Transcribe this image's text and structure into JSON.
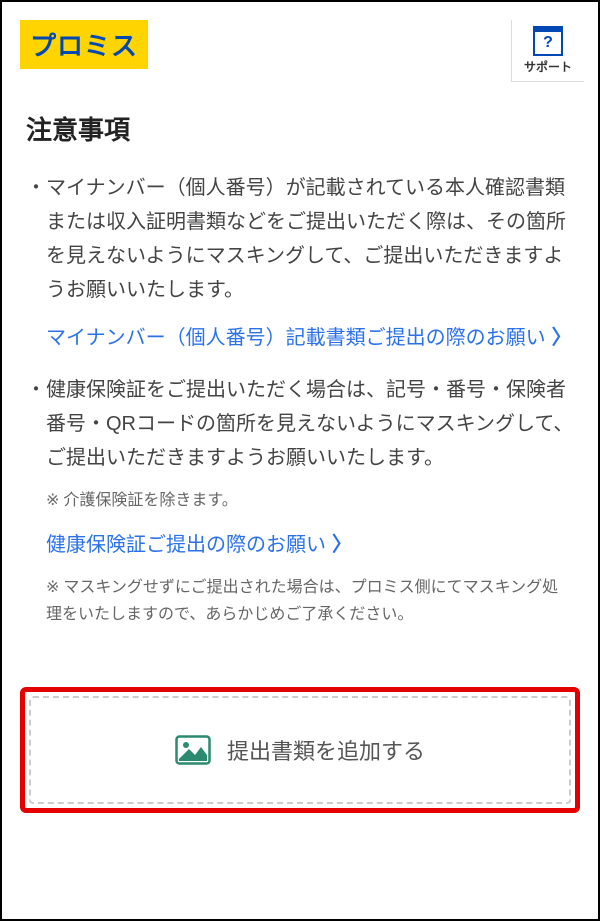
{
  "header": {
    "logo_text": "プロミス",
    "support_label": "サポート",
    "support_icon_glyph": "?"
  },
  "notice": {
    "title": "注意事項",
    "items": [
      {
        "text": "マイナンバー（個人番号）が記載されている本人確認書類または収入証明書類などをご提出いただく際は、その箇所を見えないようにマスキングして、ご提出いただきますようお願いいたします。",
        "link": "マイナンバー（個人番号）記載書類ご提出の際のお願い"
      },
      {
        "text": "健康保険証をご提出いただく場合は、記号・番号・保険者番号・QRコードの箇所を見えないようにマスキングして、ご提出いただきますようお願いいたします。",
        "footnote1": "介護保険証を除きます。",
        "link": "健康保険証ご提出の際のお願い",
        "footnote2": "マスキングせずにご提出された場合は、プロミス側にてマスキング処理をいたしますので、あらかじめご了承ください。"
      }
    ],
    "footnote_prefix": "※"
  },
  "bullet_char": "・",
  "add_document": {
    "label": "提出書類を追加する"
  }
}
